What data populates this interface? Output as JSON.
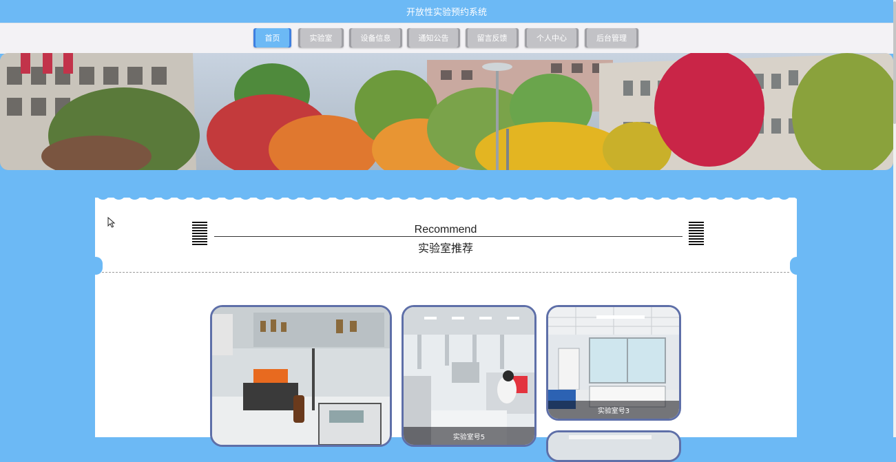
{
  "header": {
    "title": "开放性实验预约系统"
  },
  "nav": {
    "items": [
      {
        "label": "首页"
      },
      {
        "label": "实验室"
      },
      {
        "label": "设备信息"
      },
      {
        "label": "通知公告"
      },
      {
        "label": "留言反馈"
      },
      {
        "label": "个人中心"
      },
      {
        "label": "后台管理"
      }
    ],
    "active_index": 0
  },
  "recommend": {
    "title_en": "Recommend",
    "title_cn": "实验室推荐"
  },
  "cards": [
    {
      "caption": ""
    },
    {
      "caption": "实验室号5"
    },
    {
      "caption": "实验室号3"
    }
  ],
  "colors": {
    "primary": "#6cb9f5",
    "nav_bg": "#f3f2f5",
    "card_border": "#5e6fa8",
    "button_gray": "#c2c2c6"
  }
}
